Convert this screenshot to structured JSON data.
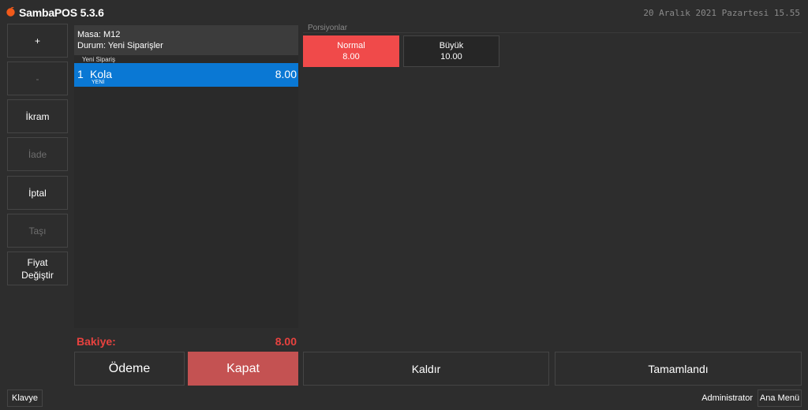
{
  "app": {
    "title": "SambaPOS 5.3.6",
    "datetime": "20 Aralık 2021 Pazartesi 15.55",
    "logo_icon": "samba-logo-icon",
    "brand_color": "#f25a1a"
  },
  "sidebar": {
    "buttons": [
      {
        "label": "+",
        "enabled": true
      },
      {
        "label": "-",
        "enabled": false
      },
      {
        "label": "İkram",
        "enabled": true
      },
      {
        "label": "İade",
        "enabled": false
      },
      {
        "label": "İptal",
        "enabled": true
      },
      {
        "label": "Taşı",
        "enabled": false
      },
      {
        "label": "Fiyat\nDeğiştir",
        "enabled": true
      }
    ]
  },
  "ticket": {
    "table_line": "Masa: M12",
    "status_line": "Durum: Yeni Siparişler",
    "order_group": "Yeni Sipariş",
    "orders": [
      {
        "qty": "1",
        "name": "Kola",
        "tag": "YENİ",
        "price": "8.00"
      }
    ],
    "balance_label": "Bakiye:",
    "balance_value": "8.00"
  },
  "portions": {
    "label": "Porsiyonlar",
    "items": [
      {
        "name": "Normal",
        "price": "8.00",
        "selected": true
      },
      {
        "name": "Büyük",
        "price": "10.00",
        "selected": false
      }
    ]
  },
  "actions": {
    "payment": "Ödeme",
    "close": "Kapat",
    "remove": "Kaldır",
    "done": "Tamamlandı"
  },
  "footer": {
    "keyboard": "Klavye",
    "user": "Administrator",
    "main_menu": "Ana Menü"
  },
  "colors": {
    "background": "#2d2d2d",
    "accent_blue": "#0a78d4",
    "accent_red": "#f04a4a",
    "balance_red": "#e8423f",
    "close_button": "#c45252"
  }
}
